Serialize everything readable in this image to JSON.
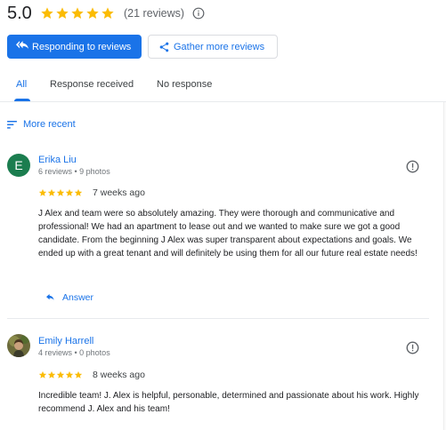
{
  "summary": {
    "rating": "5.0",
    "stars": 5,
    "count_text": "(21 reviews)"
  },
  "actions": {
    "respond_label": "Responding to reviews",
    "gather_label": "Gather more reviews"
  },
  "tabs": [
    {
      "label": "All",
      "active": true
    },
    {
      "label": "Response received",
      "active": false
    },
    {
      "label": "No response",
      "active": false
    }
  ],
  "sort": {
    "label": "More recent"
  },
  "reviews": [
    {
      "initial": "E",
      "name": "Erika Liu",
      "meta": "6 reviews • 9 photos",
      "stars": 5,
      "when": "7 weeks ago",
      "text": "J Alex and team were so absolutely amazing. They were thorough and communicative and professional! We had an apartment to lease out and we wanted to make sure we got a good candidate. From the beginning J Alex was super transparent about expectations and goals. We ended up with a great tenant and will definitely be using them for all our future real estate needs!",
      "answer_label": "Answer"
    },
    {
      "name": "Emily Harrell",
      "meta": "4 reviews • 0 photos",
      "stars": 5,
      "when": "8 weeks ago",
      "text": "Incredible team! J. Alex is helpful, personable, determined and passionate about his work. Highly recommend J. Alex and his team!"
    }
  ],
  "colors": {
    "accent": "#1a73e8",
    "star": "#fbbc04",
    "avatar_e": "#1b7d4f"
  }
}
